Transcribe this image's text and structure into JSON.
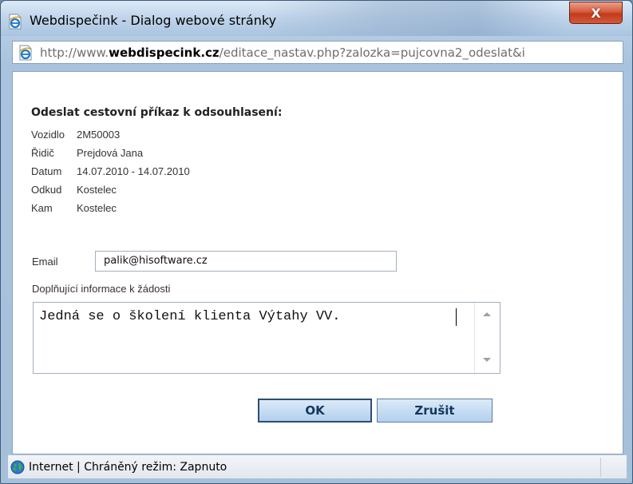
{
  "window": {
    "title": "Webdispečink - Dialog webové stránky",
    "close_label": "X"
  },
  "address": {
    "prefix": "http://www.",
    "domain": "webdispecink.cz",
    "path": "/editace_nastav.php?zalozka=pujcovna2_odeslat&i"
  },
  "form": {
    "heading": "Odeslat cestovní příkaz k odsouhlasení:",
    "fields": [
      {
        "label": "Vozidlo",
        "value": "2M50003"
      },
      {
        "label": "Řidič",
        "value": "Prejdová Jana"
      },
      {
        "label": "Datum",
        "value": "14.07.2010 - 14.07.2010"
      },
      {
        "label": "Odkud",
        "value": "Kostelec"
      },
      {
        "label": "Kam",
        "value": "Kostelec"
      }
    ],
    "email_label": "Email",
    "email_value": "palik@hisoftware.cz",
    "note_label": "Doplňující informace k žádosti",
    "note_value": "Jedná se o školení klienta Výtahy VV.",
    "ok_label": "OK",
    "cancel_label": "Zrušit"
  },
  "status": {
    "text": "Internet | Chráněný režim: Zapnuto"
  },
  "icons": {
    "app": "ie-page-icon",
    "address": "ie-page-icon",
    "status": "globe-icon"
  }
}
